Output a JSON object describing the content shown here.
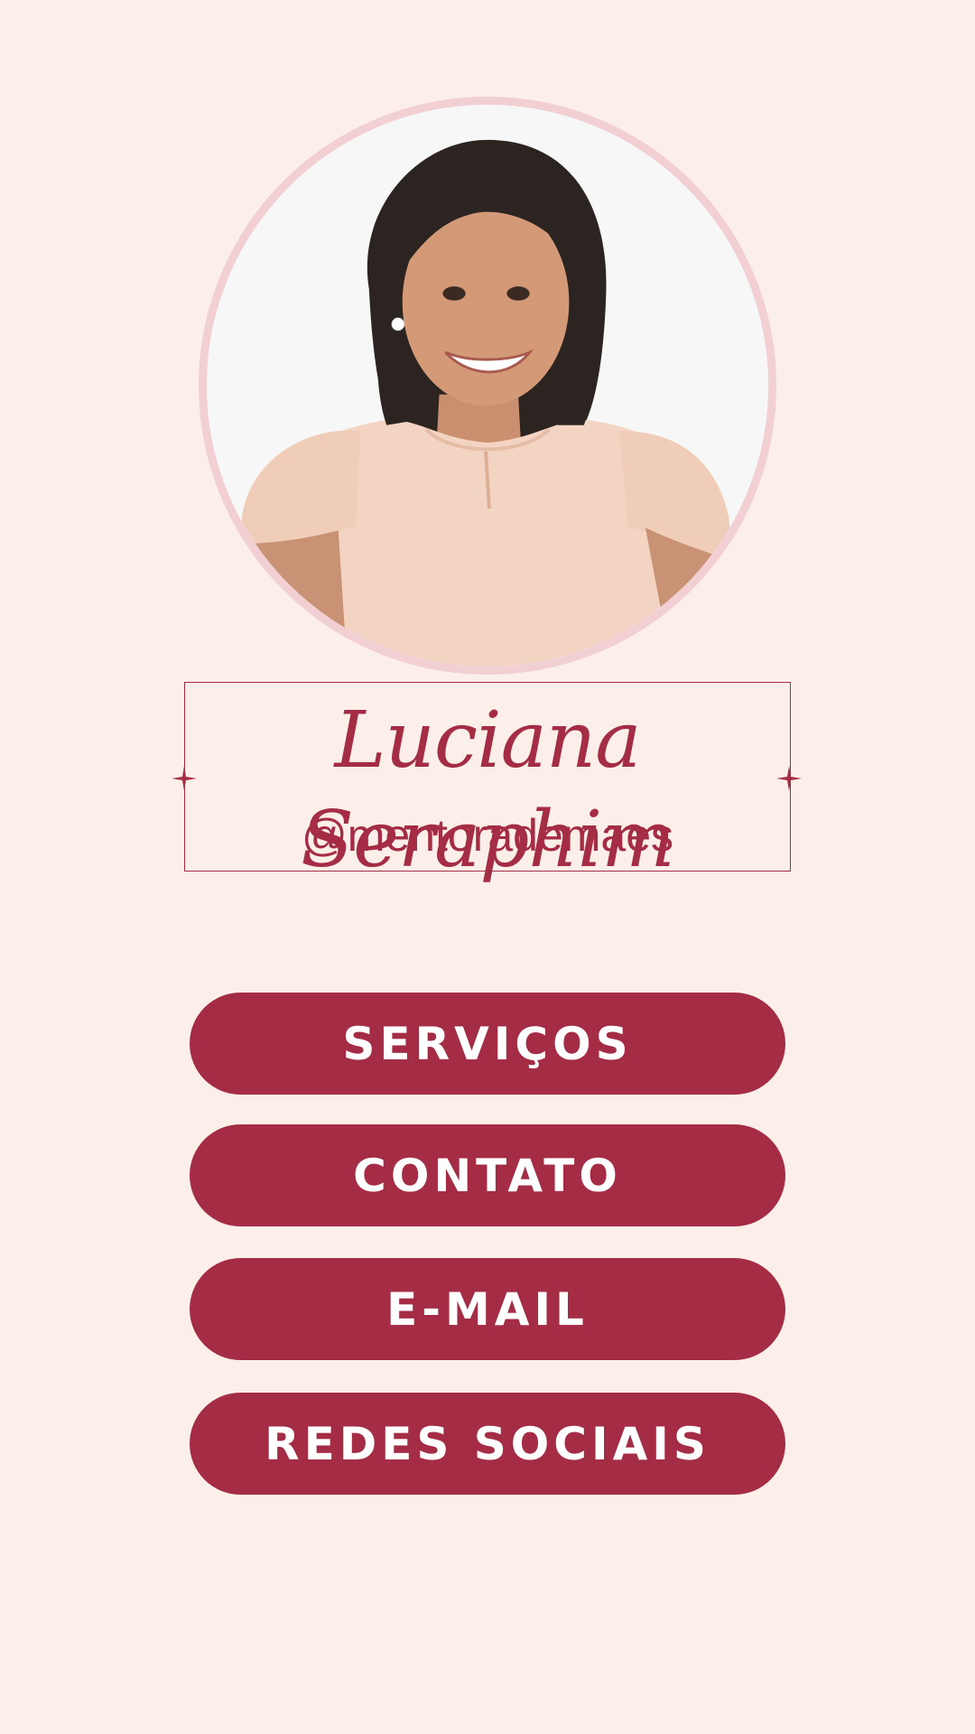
{
  "profile": {
    "name": "Luciana Seraphim",
    "handle": "@mentorademaes"
  },
  "buttons": [
    {
      "label": "SERVIÇOS"
    },
    {
      "label": "CONTATO"
    },
    {
      "label": "E-MAIL"
    },
    {
      "label": "REDES SOCIAIS"
    }
  ],
  "colors": {
    "background": "#fcefe9",
    "accent": "#a42d45",
    "avatar_border": "#f2cfd3",
    "button_text": "#ffffff"
  },
  "icons": {
    "card_ornaments": "four-point-sparkle"
  }
}
